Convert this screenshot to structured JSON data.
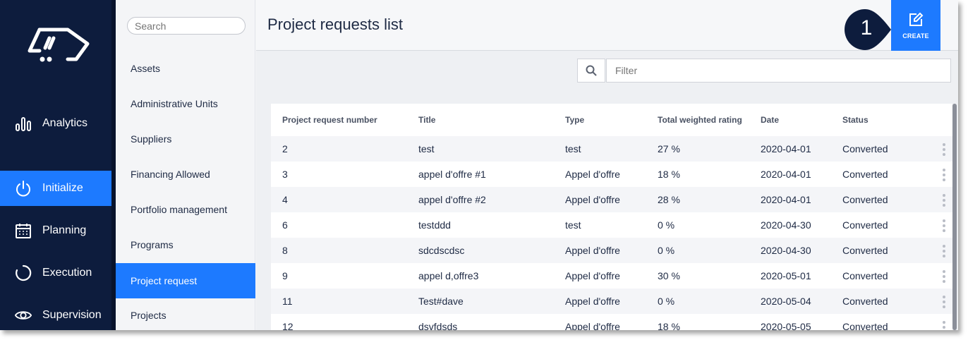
{
  "colors": {
    "nav_bg": "#0d1c3d",
    "accent": "#1d7aff",
    "main_bg": "#eef0f3"
  },
  "nav": {
    "items": [
      {
        "label": "Analytics",
        "icon": "bar-chart-icon",
        "active": false
      },
      {
        "label": "Initialize",
        "icon": "power-icon",
        "active": true
      },
      {
        "label": "Planning",
        "icon": "calendar-icon",
        "active": false
      },
      {
        "label": "Execution",
        "icon": "progress-circle-icon",
        "active": false
      },
      {
        "label": "Supervision",
        "icon": "eye-icon",
        "active": false
      }
    ]
  },
  "submenu": {
    "search_placeholder": "Search",
    "items": [
      {
        "label": "Assets"
      },
      {
        "label": "Administrative Units"
      },
      {
        "label": "Suppliers"
      },
      {
        "label": "Financing Allowed"
      },
      {
        "label": "Portfolio management"
      },
      {
        "label": "Programs"
      },
      {
        "label": "Project request",
        "active": true
      },
      {
        "label": "Projects"
      }
    ]
  },
  "header": {
    "title": "Project requests list",
    "create_label": "CREATE",
    "callout_number": "1"
  },
  "filter": {
    "placeholder": "Filter",
    "icon": "search-icon"
  },
  "table": {
    "columns": [
      "Project request number",
      "Title",
      "Type",
      "Total weighted rating",
      "Date",
      "Status"
    ],
    "rows": [
      [
        "2",
        "test",
        "test",
        "27 %",
        "2020-04-01",
        "Converted"
      ],
      [
        "3",
        "appel d'offre #1",
        "Appel d'offre",
        "18 %",
        "2020-04-01",
        "Converted"
      ],
      [
        "4",
        "appel d'offre #2",
        "Appel d'offre",
        "28 %",
        "2020-04-01",
        "Converted"
      ],
      [
        "6",
        "testddd",
        "test",
        "0 %",
        "2020-04-30",
        "Converted"
      ],
      [
        "8",
        "sdcdscdsc",
        "Appel d'offre",
        "0 %",
        "2020-04-30",
        "Converted"
      ],
      [
        "9",
        "appel d,offre3",
        "Appel d'offre",
        "30 %",
        "2020-05-01",
        "Converted"
      ],
      [
        "11",
        "Test#dave",
        "Appel d'offre",
        "0 %",
        "2020-05-04",
        "Converted"
      ],
      [
        "12",
        "dsvfdsds",
        "Appel d'offre",
        "18 %",
        "2020-05-05",
        "Converted"
      ]
    ]
  }
}
